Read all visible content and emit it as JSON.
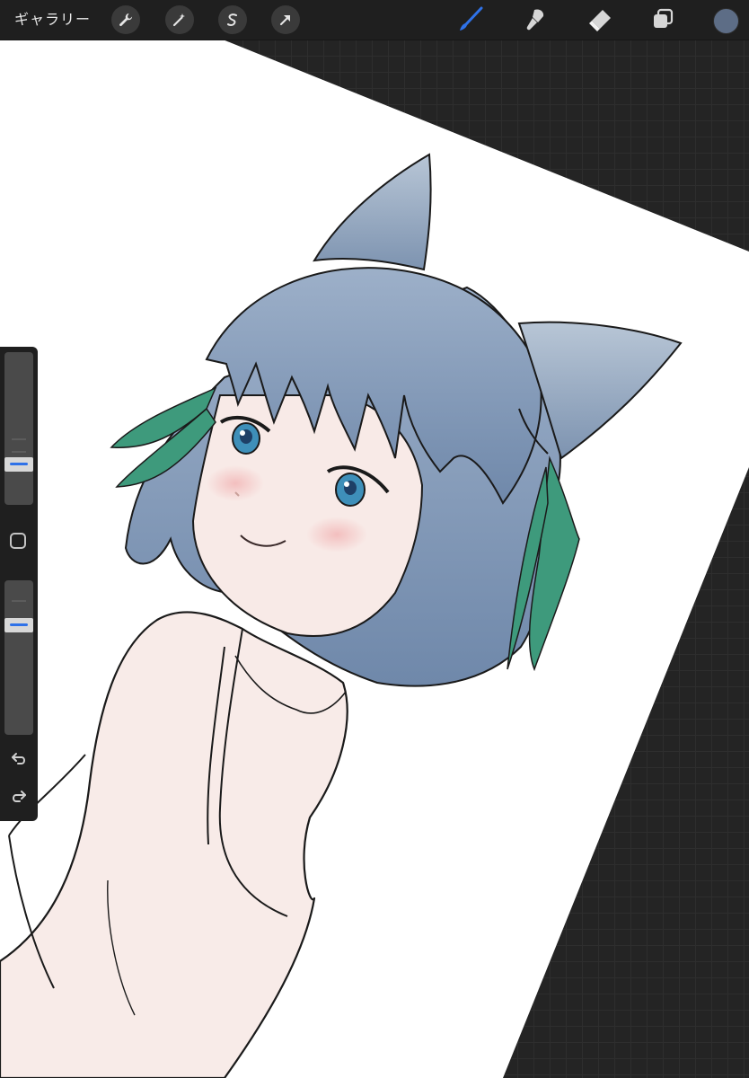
{
  "topbar": {
    "gallery_label": "ギャラリー",
    "tools": [
      {
        "name": "actions",
        "icon": "wrench-icon"
      },
      {
        "name": "adjustments",
        "icon": "magic-wand-icon"
      },
      {
        "name": "selection",
        "icon": "selection-s-icon"
      },
      {
        "name": "transform",
        "icon": "arrow-cursor-icon"
      }
    ],
    "right_tools": [
      {
        "name": "brush",
        "icon": "brush-icon",
        "active": true
      },
      {
        "name": "smudge",
        "icon": "smudge-icon"
      },
      {
        "name": "eraser",
        "icon": "eraser-icon"
      },
      {
        "name": "layers",
        "icon": "layers-icon"
      }
    ],
    "current_color": "#5d6d86",
    "active_tool_color": "#2f72e8"
  },
  "sidebar": {
    "brush_size_level": 0.24,
    "opacity_level": 0.73,
    "undo_icon": "undo-icon",
    "redo_icon": "redo-icon"
  },
  "colors": {
    "workspace": "#242424",
    "canvas": "#ffffff",
    "hair": "#7b94b5",
    "ribbon": "#3e9a7c",
    "skin": "#f6e9e6"
  }
}
